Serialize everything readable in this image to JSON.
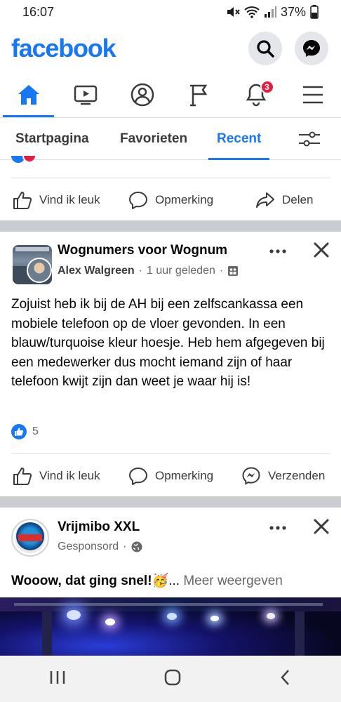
{
  "status": {
    "time": "16:07",
    "battery": "37%"
  },
  "app": {
    "logo": "facebook"
  },
  "nav": {
    "items": [
      "home-icon",
      "video-icon",
      "profile-icon",
      "flag-icon",
      "bell-icon",
      "menu-icon"
    ],
    "notifications_badge": "3"
  },
  "tabs": {
    "home": "Startpagina",
    "favorites": "Favorieten",
    "recent": "Recent"
  },
  "prev_post": {
    "like": "Vind ik leuk",
    "comment": "Opmerking",
    "share": "Delen"
  },
  "post1": {
    "group": "Wognumers voor Wognum",
    "author": "Alex Walgreen",
    "time": "1 uur geleden",
    "separator": "·",
    "text": "Zojuist heb ik bij de AH bij een zelfscankassa een mobiele telefoon op de vloer gevonden. In een blauw/turquoise kleur hoesje. Heb hem afgegeven bij een medewerker dus mocht iemand zijn of haar telefoon kwijt zijn dan weet je waar hij is!",
    "reactions_count": "5",
    "like": "Vind ik leuk",
    "comment": "Opmerking",
    "send": "Verzenden"
  },
  "post2": {
    "page": "Vrijmibo XXL",
    "sponsored": "Gesponsord",
    "separator": "·",
    "text": "Wooow, dat ging snel!",
    "emoji": "🥳",
    "ellipsis": "...",
    "see_more": "Meer weergeven"
  },
  "colors": {
    "brand": "#1877f2",
    "divider": "#c9ccd1",
    "badge": "#e41e3f"
  }
}
